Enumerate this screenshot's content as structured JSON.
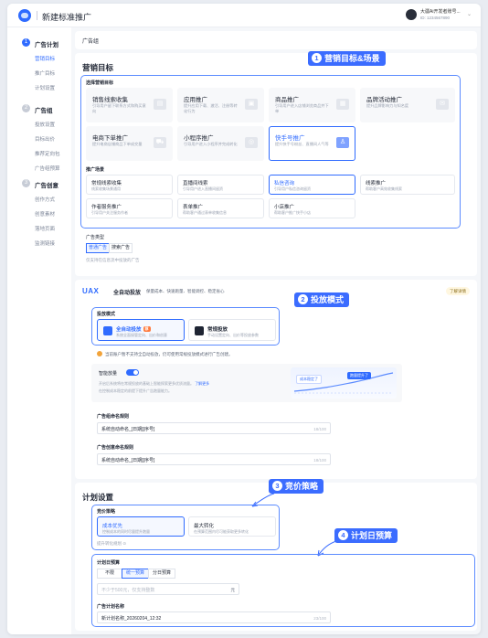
{
  "app": {
    "title": "新建标准推广"
  },
  "user": {
    "name": "大疆Ai开发者账号...",
    "id": "ID: 1234567890"
  },
  "sidebar": {
    "groups": [
      {
        "step": "1",
        "label": "广告计划",
        "items": [
          "营销目标",
          "推广目标",
          "计划设置"
        ]
      },
      {
        "step": "2",
        "label": "广告组",
        "items": [
          "投放设置",
          "目标出价",
          "推荐定向包",
          "广告组预算"
        ]
      },
      {
        "step": "3",
        "label": "广告创意",
        "items": [
          "创作方式",
          "创意素材",
          "落地页面",
          "监测链接"
        ]
      }
    ]
  },
  "breadcrumb": "广告组",
  "goal": {
    "title": "营销目标",
    "select_label": "选择营销目标",
    "tiles": [
      {
        "title": "销售线索收集",
        "desc": "引导用户留下联系方式和购买意向"
      },
      {
        "title": "应用推广",
        "desc": "提升应用下载、激活、注册等转化行为"
      },
      {
        "title": "商品推广",
        "desc": "引导用户进入店铺浏览商品并下单"
      },
      {
        "title": "品牌活动推广",
        "desc": "提升品牌影响力与知名度"
      },
      {
        "title": "电商下单推广",
        "desc": "提升电商店铺商品下单成交量"
      },
      {
        "title": "小程序推广",
        "desc": "引导用户进入小程序并完成转化"
      },
      {
        "title": "快手号推广",
        "desc": "提升快手号粉丝、直播间人气等"
      }
    ],
    "scene_label": "推广场景",
    "scenes": [
      {
        "title": "常规线索收集",
        "desc": "线索收集场景通用"
      },
      {
        "title": "直播间线索",
        "desc": "引导用户进入直播间留资"
      },
      {
        "title": "私信咨询",
        "desc": "引导用户私信咨询留资"
      },
      {
        "title": "线索推广",
        "desc": "帮助客户高效收集线索"
      },
      {
        "title": "作者服务推广",
        "desc": "引导用户关注服务作者"
      },
      {
        "title": "表单推广",
        "desc": "帮助客户通过表单收集信息"
      },
      {
        "title": "小店推广",
        "desc": "帮助客户推广快手小店"
      }
    ],
    "ad_type_label": "广告类型",
    "ad_types": [
      "普通广告",
      "搜索广告"
    ],
    "ad_type_hint": "仅支持在信息流中投放的广告"
  },
  "callouts": {
    "one": {
      "num": "1",
      "text": "营销目标&场景"
    },
    "two": {
      "num": "2",
      "text": "投放模式"
    },
    "three": {
      "num": "3",
      "text": "竞价策略"
    },
    "four": {
      "num": "4",
      "text": "计划日预算"
    }
  },
  "uax": {
    "logo": "UAX",
    "sub": "全自动投放",
    "tags": "保量成本、快速跑量、智能调控、稳定省心",
    "learn_more": "了解详情",
    "mode_label": "投放模式",
    "modes": [
      {
        "title": "全自动投放",
        "tag": "荐",
        "desc": "系统全面接管定向、出价和创意"
      },
      {
        "title": "常规投放",
        "desc": "手动设置定向、出价等投放参数"
      }
    ],
    "warning": "当前账户暂不支持全自动投放，仍可使用常规投放模式进行广告创建。",
    "smart_label": "智能放量",
    "smart_desc_1": "开启后系统将在常规投放的基础上智能探索更多优质流量。",
    "smart_desc_2": "在控制成本稳定的前提下提升广告跑量能力。",
    "smart_link": "了解更多",
    "graph_bubble_1": "成本稳定了",
    "graph_bubble_2": "跑量提升了",
    "plan_name_label": "广告组命名规则",
    "plan_name_value": "系统自动命名_[日期][序号]",
    "plan_name_count": "18/100",
    "creative_name_label": "广告创意命名规则",
    "creative_name_value": "系统自动命名_[日期][序号]",
    "creative_name_count": "18/100"
  },
  "plan": {
    "title": "计划设置",
    "bid_label": "竞价策略",
    "bids": [
      {
        "title": "成本优先",
        "desc": "控制成本的同时尽量提升跑量"
      },
      {
        "title": "最大转化",
        "desc": "在预算范围内尽可能获取更多转化"
      }
    ],
    "bid_hint": "提升转化规划 ⊙",
    "budget_label": "计划日预算",
    "budget_options": [
      "不限",
      "统一预算",
      "分日预算"
    ],
    "budget_placeholder": "不少于500元，仅支持整数",
    "budget_unit": "元",
    "name_label": "广告计划名称",
    "name_value": "新计划名称_20260204_12:32",
    "name_count": "23/100"
  }
}
